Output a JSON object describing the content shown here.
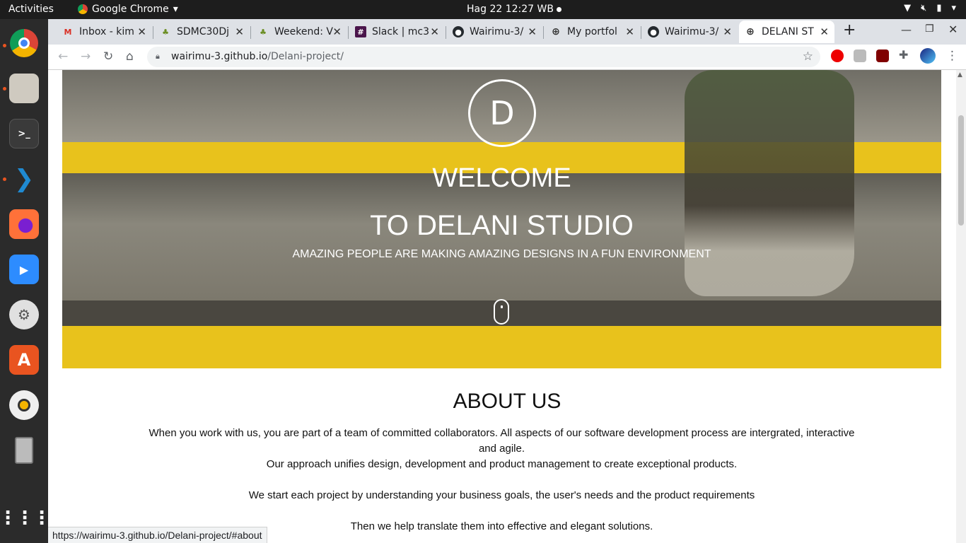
{
  "topbar": {
    "activities": "Activities",
    "app_name": "Google Chrome",
    "clock": "Hag 22  12:27 WB"
  },
  "tabs": [
    {
      "title": "Inbox - kim",
      "icon": "gmail-icon"
    },
    {
      "title": "SDMC30Dj",
      "icon": "tree-icon"
    },
    {
      "title": "Weekend: V",
      "icon": "tree-icon"
    },
    {
      "title": "Slack | mc3",
      "icon": "slack-icon"
    },
    {
      "title": "Wairimu-3/",
      "icon": "github-icon"
    },
    {
      "title": "My portfol",
      "icon": "globe-icon"
    },
    {
      "title": "Wairimu-3/",
      "icon": "github-icon"
    },
    {
      "title": "DELANI ST",
      "icon": "globe-icon"
    }
  ],
  "address": {
    "host": "wairimu-3.github.io",
    "path": "/Delani-project/"
  },
  "hero": {
    "logo_letter": "D",
    "welcome": "WELCOME",
    "title": "TO DELANI STUDIO",
    "tagline": "AMAZING PEOPLE ARE MAKING AMAZING DESIGNS IN A FUN ENVIRONMENT"
  },
  "about": {
    "heading": "ABOUT US",
    "p1": "When you work with us, you are part of a team of committed collaborators. All aspects of our software development process are intergrated, interactive and agile.",
    "p2": "Our approach unifies design, development and product management to create exceptional products.",
    "p3": "We start each project by understanding your business goals, the user's needs and the product requirements",
    "p4": "Then we help translate them into effective and elegant solutions."
  },
  "status_url": "https://wairimu-3.github.io/Delani-project/#about",
  "colors": {
    "stripe_yellow": "#e8c21c",
    "gmail_red": "#d93025",
    "slack_purple": "#4a154b"
  }
}
